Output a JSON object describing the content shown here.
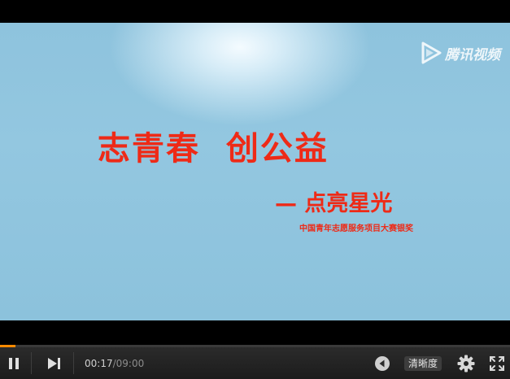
{
  "video": {
    "watermark": "腾讯视频",
    "headline": "志青春  创公益",
    "subline": "— 点亮星光",
    "award": "中国青年志愿服务项目大赛银奖"
  },
  "progress": {
    "played_fraction": 0.031,
    "color": "#ff8a00"
  },
  "controls": {
    "current_time": "00:17",
    "separator": "/",
    "total_time": "09:00",
    "quality_label": "清晰度",
    "icons": [
      "pause-icon",
      "next-icon",
      "danmaku-icon",
      "settings-gear-icon",
      "fullscreen-icon"
    ]
  },
  "colors": {
    "accent_text": "#ee2a17",
    "background": "#000000"
  }
}
